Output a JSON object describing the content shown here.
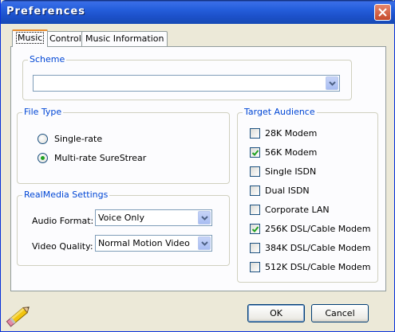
{
  "window": {
    "title": "Preferences"
  },
  "tabs": [
    "Music",
    "Control",
    "Music Information"
  ],
  "scheme": {
    "label": "Scheme",
    "value": ""
  },
  "file_type": {
    "label": "File Type",
    "options": [
      {
        "label": "Single-rate",
        "checked": false
      },
      {
        "label": "Multi-rate SureStrear",
        "checked": true
      }
    ]
  },
  "realmedia": {
    "label": "RealMedia Settings",
    "audio_format_label": "Audio Format:",
    "audio_format_value": "Voice Only",
    "video_quality_label": "Video Quality:",
    "video_quality_value": "Normal Motion Video"
  },
  "target_audience": {
    "label": "Target Audience",
    "items": [
      {
        "label": "28K Modem",
        "checked": false
      },
      {
        "label": "56K Modem",
        "checked": true
      },
      {
        "label": "Single ISDN",
        "checked": false
      },
      {
        "label": "Dual ISDN",
        "checked": false
      },
      {
        "label": "Corporate LAN",
        "checked": false
      },
      {
        "label": "256K DSL/Cable Modem",
        "checked": true
      },
      {
        "label": "384K DSL/Cable Modem",
        "checked": false
      },
      {
        "label": "512K DSL/Cable Modem",
        "checked": false
      }
    ]
  },
  "buttons": {
    "ok": "OK",
    "cancel": "Cancel"
  },
  "icons": {
    "close": "close-icon",
    "pencil": "pencil-icon",
    "dropdown": "chevron-down-icon",
    "check": "checkmark-icon"
  },
  "colors": {
    "titlebar": "#245edb",
    "group_label": "#0046d5",
    "check_mark": "#21a121",
    "active_tab_accent": "#e68b2c"
  }
}
